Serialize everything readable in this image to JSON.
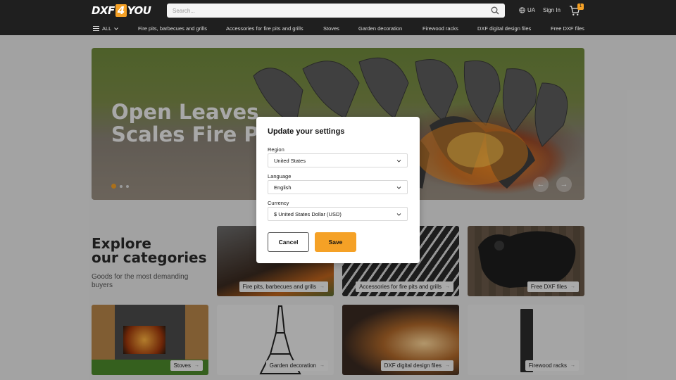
{
  "header": {
    "logo_left": "DXF",
    "logo_mid": "4",
    "logo_right": "YOU",
    "search_placeholder": "Search...",
    "language": "UA",
    "sign_in": "Sign In",
    "cart_count": "1",
    "accent_color": "#f5a126"
  },
  "nav": {
    "all_label": "ALL",
    "items": [
      "Fire pits, barbecues and grills",
      "Accessories for fire pits and grills",
      "Stoves",
      "Garden decoration",
      "Firewood racks",
      "DXF digital design files",
      "Free DXF files"
    ]
  },
  "hero": {
    "title": "Open Leaves\nScales Fire Pi",
    "prev_icon": "arrow-left-icon",
    "next_icon": "arrow-right-icon"
  },
  "categories": {
    "heading": "Explore\nour categories",
    "subheading": "Goods for the most demanding buyers",
    "cards": [
      "Fire pits, barbecues and grills",
      "Accessories for fire pits and grills",
      "Free DXF files",
      "Stoves",
      "Garden decoration",
      "DXF digital design files",
      "Firewood racks"
    ]
  },
  "modal": {
    "title": "Update your settings",
    "region_label": "Region",
    "region_value": "United States",
    "language_label": "Language",
    "language_value": "English",
    "currency_label": "Currency",
    "currency_value": "$ United States Dollar (USD)",
    "cancel_label": "Cancel",
    "save_label": "Save"
  }
}
